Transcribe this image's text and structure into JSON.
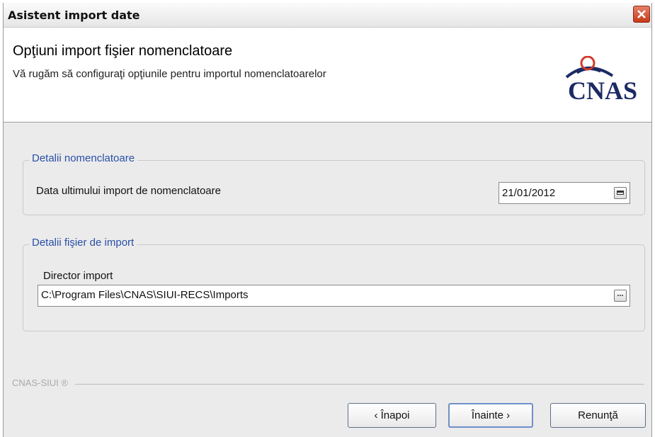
{
  "window": {
    "title": "Asistent import date"
  },
  "header": {
    "title": "Opţiuni import fişier nomenclatoare",
    "subtitle": "Vă rugăm să configuraţi opţiunile pentru importul nomenclatoarelor",
    "logo_text": "CNAS"
  },
  "group_nomenclator": {
    "legend": "Detalii nomenclatoare",
    "date_label": "Data ultimului import de nomenclatoare",
    "date_value": "21/01/2012"
  },
  "group_file": {
    "legend": "Detalii fişier de import",
    "dir_label": "Director import",
    "dir_value": "C:\\Program Files\\CNAS\\SIUI-RECS\\Imports",
    "browse_label": "..."
  },
  "footer": {
    "brand": "CNAS-SIUI ®",
    "back": "‹ Înapoi",
    "next": "Înainte ›",
    "cancel": "Renunţă"
  },
  "colors": {
    "legend": "#2a4fa8",
    "close": "#c8391a",
    "logo": "#1c2a64"
  }
}
